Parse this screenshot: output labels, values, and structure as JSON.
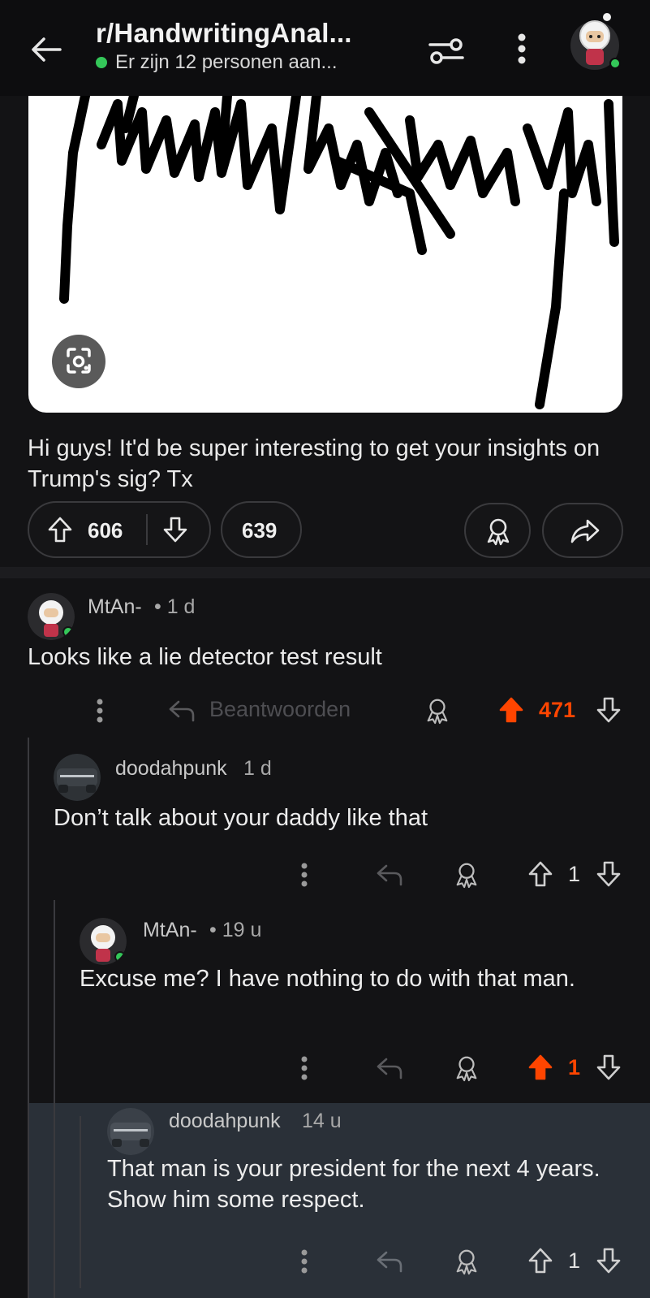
{
  "header": {
    "title": "r/HandwritingAnal...",
    "online_text": "Er zijn 12 personen aan...",
    "accent": "#34c759"
  },
  "post": {
    "body": "Hi guys! It'd be super interesting to get your insights on Trump's sig? Tx",
    "upvotes": "606",
    "comments": "639"
  },
  "comments": [
    {
      "author": "MtAn-",
      "age": "• 1 d",
      "text": "Looks like a lie detector test result",
      "reply_label": "Beantwoorden",
      "score": "471",
      "upvoted": true
    },
    {
      "author": "doodahpunk",
      "age": "1 d",
      "text": "Don’t talk about your daddy like that",
      "score": "1",
      "upvoted": false
    },
    {
      "author": "MtAn-",
      "age": "• 19 u",
      "text": "Excuse me? I have nothing to do with that man.",
      "score": "1",
      "upvoted": true
    },
    {
      "author": "doodahpunk",
      "age": "14 u",
      "text": "That man is your president for the next 4 years. Show him some respect.",
      "score": "1",
      "upvoted": false
    }
  ],
  "colors": {
    "background": "#131315",
    "upvote": "#ff4500",
    "highlight": "#2a3038"
  }
}
